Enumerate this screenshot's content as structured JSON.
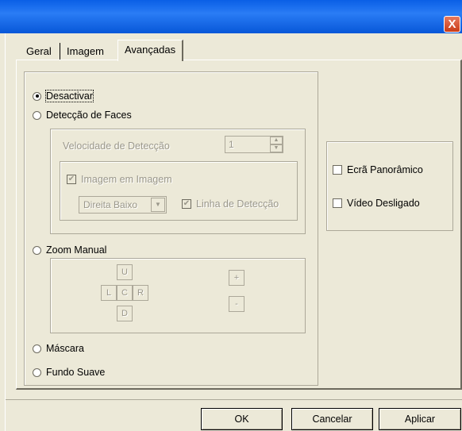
{
  "window": {
    "close_glyph": "X"
  },
  "tabs": [
    {
      "label": "Geral"
    },
    {
      "label": "Imagem"
    },
    {
      "label": "Avançadas"
    }
  ],
  "options": {
    "desactivar": {
      "label": "Desactivar",
      "checked": true
    },
    "deteccao_faces": {
      "label": "Detecção de Faces",
      "velocidade_label": "Velocidade de Detecção",
      "velocidade_value": "1",
      "imagem_em_imagem": "Imagem em Imagem",
      "posicao_value": "Direita Baixo",
      "linha_deteccao": "Linha de Detecção"
    },
    "zoom_manual": {
      "label": "Zoom Manual",
      "up": "U",
      "left": "L",
      "center": "C",
      "right": "R",
      "down": "D",
      "plus": "+",
      "minus": "-"
    },
    "mascara": {
      "label": "Máscara"
    },
    "fundo_suave": {
      "label": "Fundo Suave"
    }
  },
  "side_options": {
    "ecra_panoramico": "Ecrã Panorâmico",
    "video_desligado": "Vídeo Desligado"
  },
  "buttons": {
    "ok": "OK",
    "cancelar": "Cancelar",
    "aplicar": "Aplicar"
  }
}
